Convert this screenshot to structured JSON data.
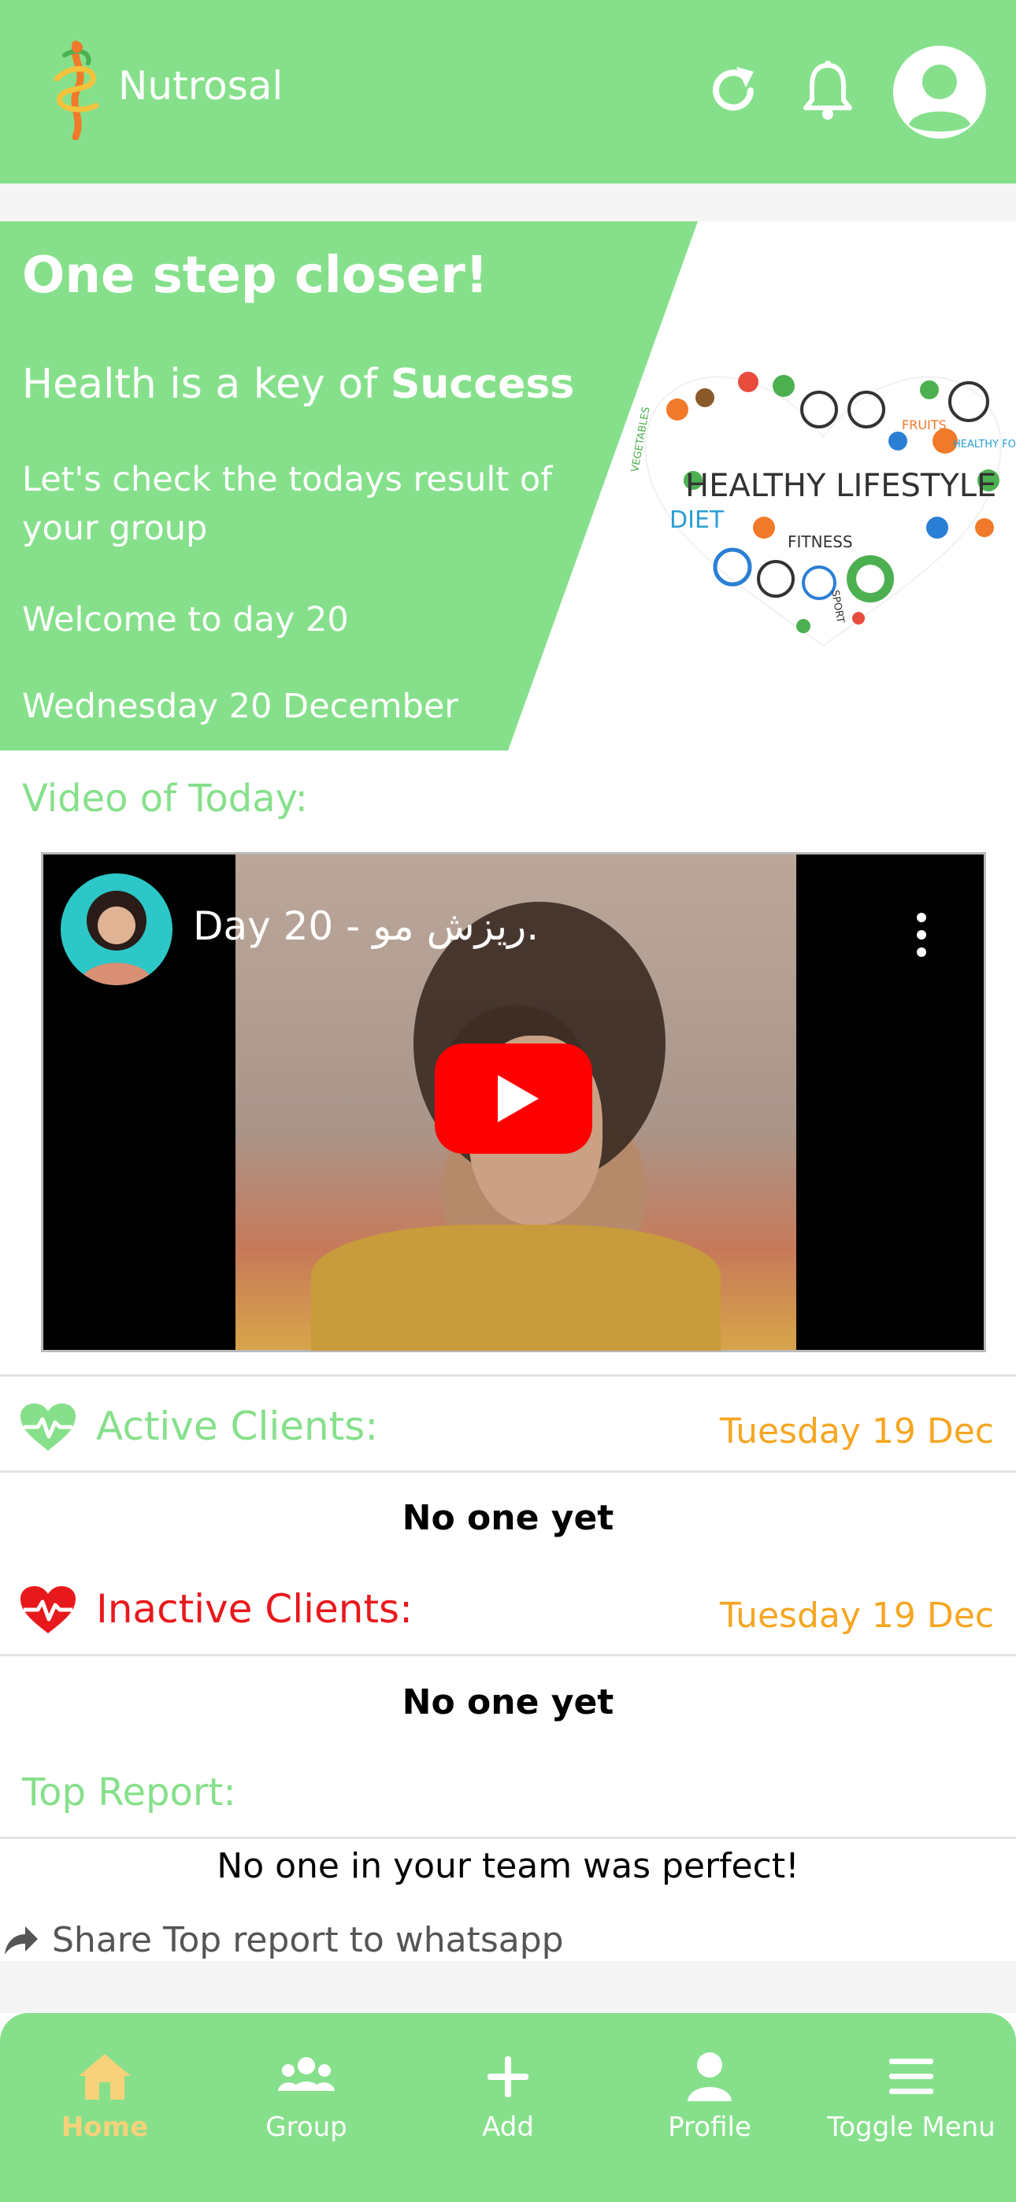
{
  "header": {
    "app_title": "Nutrosal"
  },
  "hero": {
    "title": "One step closer!",
    "subtitle_prefix": "Health is a key of ",
    "subtitle_bold": "Success",
    "cta": "Let's check the todays result of your group",
    "day": "Welcome to day 20",
    "date": "Wednesday 20 December",
    "image_text": {
      "main": "HEALTHY LIFESTYLE",
      "diet": "DIET",
      "fitness": "FITNESS",
      "fruits": "FRUITS",
      "healthy_food": "HEALTHY FOOD",
      "vegetables": "VEGETABLES",
      "sport": "SPORT"
    }
  },
  "video": {
    "section_title": "Video of Today:",
    "title": "Day 20 - ریزش مو."
  },
  "active_clients": {
    "title": "Active Clients:",
    "date": "Tuesday 19 Dec",
    "empty": "No one yet"
  },
  "inactive_clients": {
    "title": "Inactive Clients:",
    "date": "Tuesday 19 Dec",
    "empty": "No one yet"
  },
  "top_report": {
    "title": "Top Report:",
    "message": "No one in your team was perfect!",
    "share_label": "Share Top report to whatsapp"
  },
  "nav": {
    "home": "Home",
    "group": "Group",
    "add": "Add",
    "profile": "Profile",
    "toggle_menu": "Toggle Menu",
    "active_item": "Home"
  },
  "colors": {
    "brand_green": "#86e08b",
    "date_orange": "#f5a623",
    "inactive_red": "#e8191c",
    "active_nav": "#f7d27a"
  },
  "icons": {
    "refresh": "refresh-icon",
    "notifications": "bell-icon",
    "account": "user-circle-icon",
    "active_clients": "heartbeat-icon",
    "inactive_clients": "heartbeat-icon",
    "share": "share-arrow-icon",
    "home": "home-icon",
    "group": "users-icon",
    "add": "plus-icon",
    "profile": "user-icon",
    "toggle_menu": "hamburger-icon",
    "video_menu": "kebab-icon",
    "play": "play-icon"
  }
}
